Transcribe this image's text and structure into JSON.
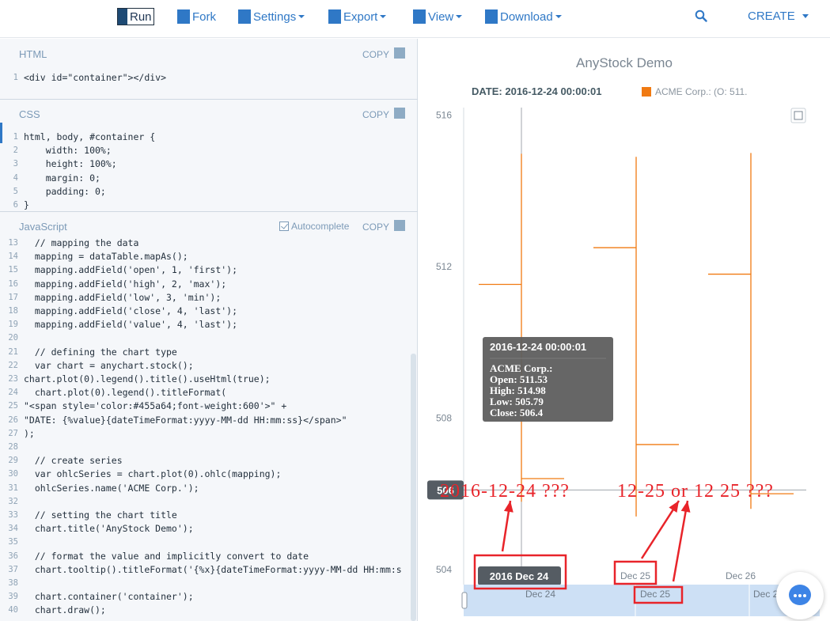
{
  "nav": {
    "run": "Run",
    "fork": "Fork",
    "settings": "Settings",
    "export": "Export",
    "view": "View",
    "download": "Download",
    "create": "CREATE"
  },
  "panels": {
    "html": {
      "title": "HTML",
      "copy": "COPY",
      "lines": [
        {
          "n": "1",
          "t": "<div id=\"container\"></div>"
        }
      ]
    },
    "css": {
      "title": "CSS",
      "copy": "COPY",
      "lines": [
        {
          "n": "1",
          "t": "html, body, #container {"
        },
        {
          "n": "2",
          "t": "    width: 100%;"
        },
        {
          "n": "3",
          "t": "    height: 100%;"
        },
        {
          "n": "4",
          "t": "    margin: 0;"
        },
        {
          "n": "5",
          "t": "    padding: 0;"
        },
        {
          "n": "6",
          "t": "}"
        }
      ]
    },
    "js": {
      "title": "JavaScript",
      "copy": "COPY",
      "autocomplete": "Autocomplete",
      "lines": [
        {
          "n": "13",
          "t": "  // mapping the data"
        },
        {
          "n": "14",
          "t": "  mapping = dataTable.mapAs();"
        },
        {
          "n": "15",
          "t": "  mapping.addField('open', 1, 'first');"
        },
        {
          "n": "16",
          "t": "  mapping.addField('high', 2, 'max');"
        },
        {
          "n": "17",
          "t": "  mapping.addField('low', 3, 'min');"
        },
        {
          "n": "18",
          "t": "  mapping.addField('close', 4, 'last');"
        },
        {
          "n": "19",
          "t": "  mapping.addField('value', 4, 'last');"
        },
        {
          "n": "20",
          "t": ""
        },
        {
          "n": "21",
          "t": "  // defining the chart type"
        },
        {
          "n": "22",
          "t": "  var chart = anychart.stock();"
        },
        {
          "n": "23",
          "t": "chart.plot(0).legend().title().useHtml(true);"
        },
        {
          "n": "24",
          "t": "  chart.plot(0).legend().titleFormat("
        },
        {
          "n": "25",
          "t": "\"<span style='color:#455a64;font-weight:600'>\" +"
        },
        {
          "n": "26",
          "t": "\"DATE: {%value}{dateTimeFormat:yyyy-MM-dd HH:mm:ss}</span>\""
        },
        {
          "n": "27",
          "t": ");"
        },
        {
          "n": "28",
          "t": ""
        },
        {
          "n": "29",
          "t": "  // create series"
        },
        {
          "n": "30",
          "t": "  var ohlcSeries = chart.plot(0).ohlc(mapping);"
        },
        {
          "n": "31",
          "t": "  ohlcSeries.name('ACME Corp.');"
        },
        {
          "n": "32",
          "t": ""
        },
        {
          "n": "33",
          "t": "  // setting the chart title"
        },
        {
          "n": "34",
          "t": "  chart.title('AnyStock Demo');"
        },
        {
          "n": "35",
          "t": ""
        },
        {
          "n": "36",
          "t": "  // format the value and implicitly convert to date"
        },
        {
          "n": "37",
          "t": "  chart.tooltip().titleFormat('{%x}{dateTimeFormat:yyyy-MM-dd HH:mm:s"
        },
        {
          "n": "38",
          "t": ""
        },
        {
          "n": "39",
          "t": "  chart.container('container');"
        },
        {
          "n": "40",
          "t": "  chart.draw();"
        }
      ]
    }
  },
  "chart_data": {
    "type": "ohlc",
    "title": "AnyStock Demo",
    "legend": {
      "date_label": "DATE: 2016-12-24 00:00:01",
      "series_label": "ACME Corp.: (O: 511."
    },
    "ylim": [
      503.6,
      516.2
    ],
    "y_ticks": [
      504,
      508,
      512,
      516
    ],
    "x_labels": [
      "2016 Dec 24",
      "Dec 25",
      "Dec 26"
    ],
    "scroller_labels": [
      "Dec 24",
      "Dec 25",
      "Dec 2"
    ],
    "crosshair_y_label": "506",
    "series": [
      {
        "name": "ACME Corp.",
        "color": "#f07a12",
        "points": [
          {
            "date": "2016-12-24",
            "open": 511.53,
            "high": 514.98,
            "low": 505.79,
            "close": 506.4
          },
          {
            "date": "2016-12-25",
            "open": 512.5,
            "high": 514.9,
            "low": 505.4,
            "close": 507.3
          },
          {
            "date": "2016-12-26",
            "open": 511.8,
            "high": 515.0,
            "low": 505.6,
            "close": 506.0
          }
        ]
      }
    ],
    "tooltip": {
      "title": "2016-12-24 00:00:01",
      "lines": [
        "ACME Corp.:",
        "Open: 511.53",
        "High: 514.98",
        "Low: 505.79",
        "Close: 506.4"
      ]
    },
    "annotations": {
      "text1": "2016-12-24 ???",
      "text2": "12-25 or 12 25 ???",
      "color": "#e8242a"
    }
  }
}
